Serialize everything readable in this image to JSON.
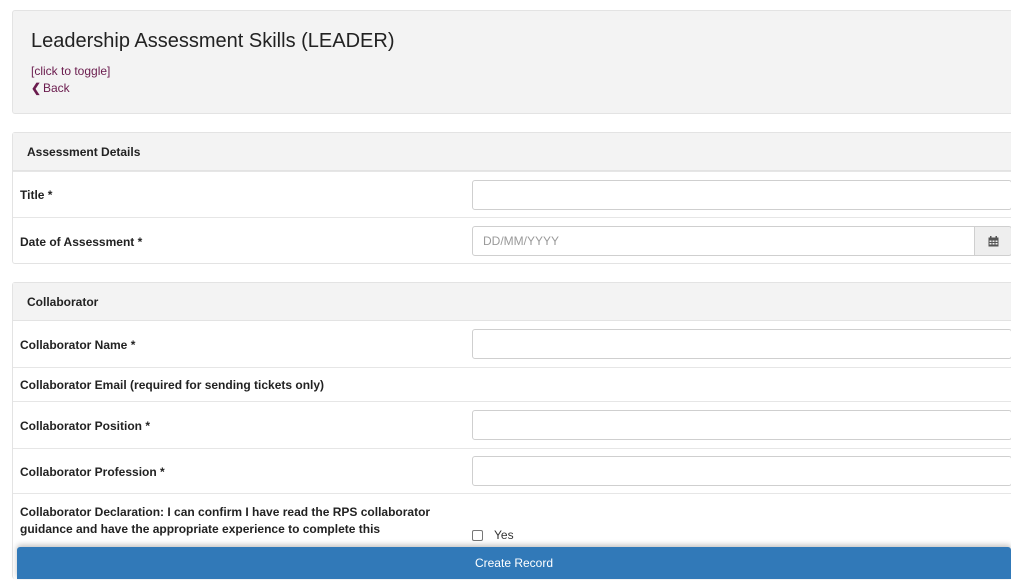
{
  "header": {
    "title": "Leadership Assessment Skills (LEADER)",
    "toggle_label": "[click to toggle]",
    "back_label": "Back"
  },
  "assessment_details": {
    "heading": "Assessment Details",
    "title_label": "Title *",
    "title_value": "",
    "date_label": "Date of Assessment *",
    "date_placeholder": "DD/MM/YYYY"
  },
  "collaborator": {
    "heading": "Collaborator",
    "name_label": "Collaborator Name *",
    "email_label": "Collaborator Email (required for sending tickets only)",
    "position_label": "Collaborator Position *",
    "profession_label": "Collaborator Profession *",
    "declaration_text": "Collaborator Declaration: I can confirm I have read the RPS collaborator guidance and have the appropriate experience to complete this",
    "declaration_option": "Yes"
  },
  "footer": {
    "create_label": "Create Record"
  },
  "icons": {
    "back": "chevron-left-icon",
    "calendar": "calendar-icon"
  },
  "colors": {
    "link": "#6a1b4d",
    "primary_button": "#3179b8",
    "panel_bg": "#f3f3f3"
  }
}
